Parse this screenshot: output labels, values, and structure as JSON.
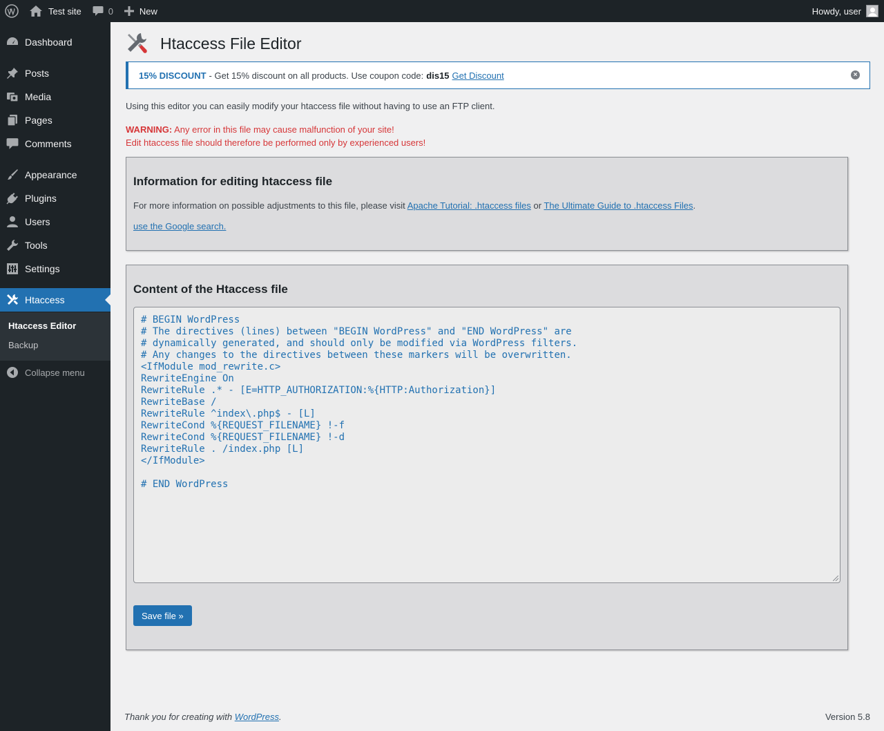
{
  "adminbar": {
    "site_name": "Test site",
    "comments_count": "0",
    "new_label": "New",
    "greeting": "Howdy, user"
  },
  "sidebar": {
    "items": [
      {
        "label": "Dashboard",
        "icon": "dashboard-icon"
      },
      {
        "label": "Posts",
        "icon": "pin-icon"
      },
      {
        "label": "Media",
        "icon": "media-icon"
      },
      {
        "label": "Pages",
        "icon": "pages-icon"
      },
      {
        "label": "Comments",
        "icon": "comment-icon"
      },
      {
        "label": "Appearance",
        "icon": "brush-icon"
      },
      {
        "label": "Plugins",
        "icon": "plugin-icon"
      },
      {
        "label": "Users",
        "icon": "user-icon"
      },
      {
        "label": "Tools",
        "icon": "wrench-icon"
      },
      {
        "label": "Settings",
        "icon": "settings-icon"
      },
      {
        "label": "Htaccess",
        "icon": "tools-icon"
      }
    ],
    "submenu": [
      "Htaccess Editor",
      "Backup"
    ],
    "collapse_label": "Collapse menu"
  },
  "page": {
    "title": "Htaccess File Editor",
    "notice": {
      "highlight": "15% DISCOUNT",
      "text": "- Get 15% discount on all products. Use coupon code:",
      "code": "dis15",
      "link": "Get Discount"
    },
    "intro": "Using this editor you can easily modify your htaccess file without having to use an FTP client.",
    "warning_label": "WARNING:",
    "warning_line1": "Any error in this file may cause malfunction of your site!",
    "warning_line2": "Edit htaccess file should therefore be performed only by experienced users!"
  },
  "info_box": {
    "heading": "Information for editing htaccess file",
    "text_before": "For more information on possible adjustments to this file, please visit",
    "link1": "Apache Tutorial: .htaccess files",
    "or": "or",
    "link2": "The Ultimate Guide to .htaccess Files",
    "period": ".",
    "google_link": "use the Google search."
  },
  "content_box": {
    "heading": "Content of the Htaccess file",
    "file_content": "# BEGIN WordPress\n# The directives (lines) between \"BEGIN WordPress\" and \"END WordPress\" are\n# dynamically generated, and should only be modified via WordPress filters.\n# Any changes to the directives between these markers will be overwritten.\n<IfModule mod_rewrite.c>\nRewriteEngine On\nRewriteRule .* - [E=HTTP_AUTHORIZATION:%{HTTP:Authorization}]\nRewriteBase /\nRewriteRule ^index\\.php$ - [L]\nRewriteCond %{REQUEST_FILENAME} !-f\nRewriteCond %{REQUEST_FILENAME} !-d\nRewriteRule . /index.php [L]\n</IfModule>\n\n# END WordPress",
    "save_label": "Save file »"
  },
  "footer": {
    "thanks_before": "Thank you for creating with",
    "wp_link": "WordPress",
    "thanks_after": ".",
    "version": "Version 5.8"
  },
  "colors": {
    "accent": "#2271b1",
    "admin_dark": "#1d2327",
    "warning": "#d63638"
  }
}
